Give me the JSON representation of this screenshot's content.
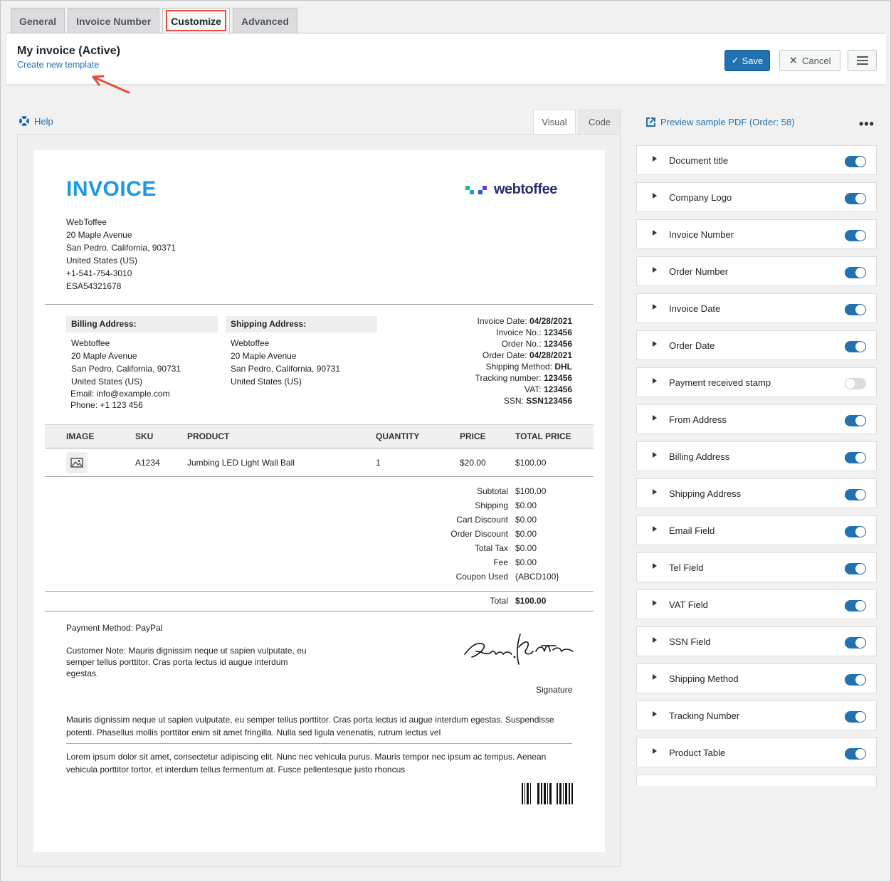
{
  "tabs": [
    {
      "label": "General"
    },
    {
      "label": "Invoice Number"
    },
    {
      "label": "Customize"
    },
    {
      "label": "Advanced"
    }
  ],
  "header": {
    "template_title": "My invoice (Active)",
    "create_link": "Create new template",
    "save_label": "Save",
    "cancel_label": "Cancel"
  },
  "editor": {
    "help_label": "Help",
    "view_tabs": {
      "visual": "Visual",
      "code": "Code"
    },
    "preview_link": "Preview sample PDF (Order: 58)",
    "more": "•••"
  },
  "invoice": {
    "title": "INVOICE",
    "logo_text": "webtoffee",
    "from": [
      "WebToffee",
      "20 Maple Avenue",
      "San Pedro, California, 90371",
      "United States (US)",
      "+1-541-754-3010",
      "ESA54321678"
    ],
    "billing_head": "Billing Address:",
    "billing": [
      "Webtoffee",
      "20 Maple Avenue",
      "San Pedro, California, 90731",
      "United States (US)",
      "Email: info@example.com",
      "Phone: +1 123 456"
    ],
    "shipping_head": "Shipping Address:",
    "shipping": [
      "Webtoffee",
      "20 Maple Avenue",
      "San Pedro, California, 90731",
      "United States (US)"
    ],
    "meta": [
      {
        "label": "Invoice Date:",
        "value": "04/28/2021"
      },
      {
        "label": "Invoice No.:",
        "value": "123456"
      },
      {
        "label": "Order No.:",
        "value": "123456"
      },
      {
        "label": "Order Date:",
        "value": "04/28/2021"
      },
      {
        "label": "Shipping Method:",
        "value": "DHL"
      },
      {
        "label": "Tracking number:",
        "value": "123456"
      },
      {
        "label": "VAT:",
        "value": "123456"
      },
      {
        "label": "SSN:",
        "value": "SSN123456"
      }
    ],
    "table": {
      "headers": [
        "IMAGE",
        "SKU",
        "PRODUCT",
        "QUANTITY",
        "PRICE",
        "TOTAL PRICE"
      ],
      "row": {
        "sku": "A1234",
        "product": "Jumbing LED Light Wall Ball",
        "qty": "1",
        "price": "$20.00",
        "total": "$100.00"
      }
    },
    "totals": [
      {
        "label": "Subtotal",
        "value": "$100.00"
      },
      {
        "label": "Shipping",
        "value": "$0.00"
      },
      {
        "label": "Cart Discount",
        "value": "$0.00"
      },
      {
        "label": "Order Discount",
        "value": "$0.00"
      },
      {
        "label": "Total Tax",
        "value": "$0.00"
      },
      {
        "label": "Fee",
        "value": "$0.00"
      },
      {
        "label": "Coupon Used",
        "value": "{ABCD100}"
      }
    ],
    "grand_total": {
      "label": "Total",
      "value": "$100.00"
    },
    "payment_method": "Payment Method: PayPal",
    "customer_note": "Customer Note: Mauris dignissim neque ut sapien vulputate, eu semper tellus porttitor. Cras porta lectus id augue interdum egestas.",
    "signature_label": "Signature",
    "footer_1": "Mauris dignissim neque ut sapien vulputate, eu semper tellus porttitor. Cras porta lectus id augue interdum egestas. Suspendisse potenti. Phasellus mollis porttitor enim sit amet fringilla. Nulla sed ligula venenatis, rutrum lectus vel",
    "footer_2": "Lorem ipsum dolor sit amet, consectetur adipiscing elit. Nunc nec vehicula purus. Mauris tempor nec ipsum ac tempus. Aenean vehicula porttitor tortor, et interdum tellus fermentum at. Fusce pellentesque justo rhoncus"
  },
  "panel_items": [
    {
      "label": "Document title",
      "on": true
    },
    {
      "label": "Company Logo",
      "on": true
    },
    {
      "label": "Invoice Number",
      "on": true
    },
    {
      "label": "Order Number",
      "on": true
    },
    {
      "label": "Invoice Date",
      "on": true
    },
    {
      "label": "Order Date",
      "on": true
    },
    {
      "label": "Payment received stamp",
      "on": false
    },
    {
      "label": "From Address",
      "on": true
    },
    {
      "label": "Billing Address",
      "on": true
    },
    {
      "label": "Shipping Address",
      "on": true
    },
    {
      "label": "Email Field",
      "on": true
    },
    {
      "label": "Tel Field",
      "on": true
    },
    {
      "label": "VAT Field",
      "on": true
    },
    {
      "label": "SSN Field",
      "on": true
    },
    {
      "label": "Shipping Method",
      "on": true
    },
    {
      "label": "Tracking Number",
      "on": true
    },
    {
      "label": "Product Table",
      "on": true
    }
  ],
  "colors": {
    "accent": "#2271b1",
    "invoice_title": "#1a9ae3",
    "highlight": "#e54e3f"
  }
}
